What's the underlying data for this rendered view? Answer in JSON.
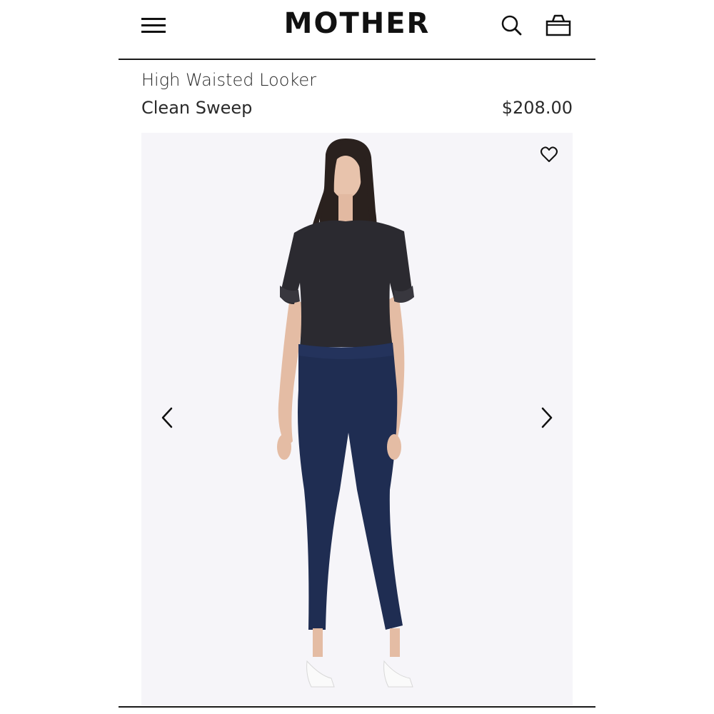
{
  "header": {
    "brand": "MOTHER",
    "menu_icon": "hamburger-menu-icon",
    "search_icon": "search-icon",
    "bag_icon": "shopping-bag-icon"
  },
  "product": {
    "name": "High Waisted Looker",
    "color": "Clean Sweep",
    "price": "$208.00"
  },
  "gallery": {
    "wishlist_icon": "heart-icon",
    "prev_icon": "chevron-left-icon",
    "next_icon": "chevron-right-icon",
    "image_subject": "model-wearing-dark-tee-and-skinny-jeans"
  },
  "colors": {
    "text": "#1a1a1a",
    "gallery_bg": "#f6f5f9",
    "denim": "#1f2d52",
    "tee": "#2b2a30"
  }
}
